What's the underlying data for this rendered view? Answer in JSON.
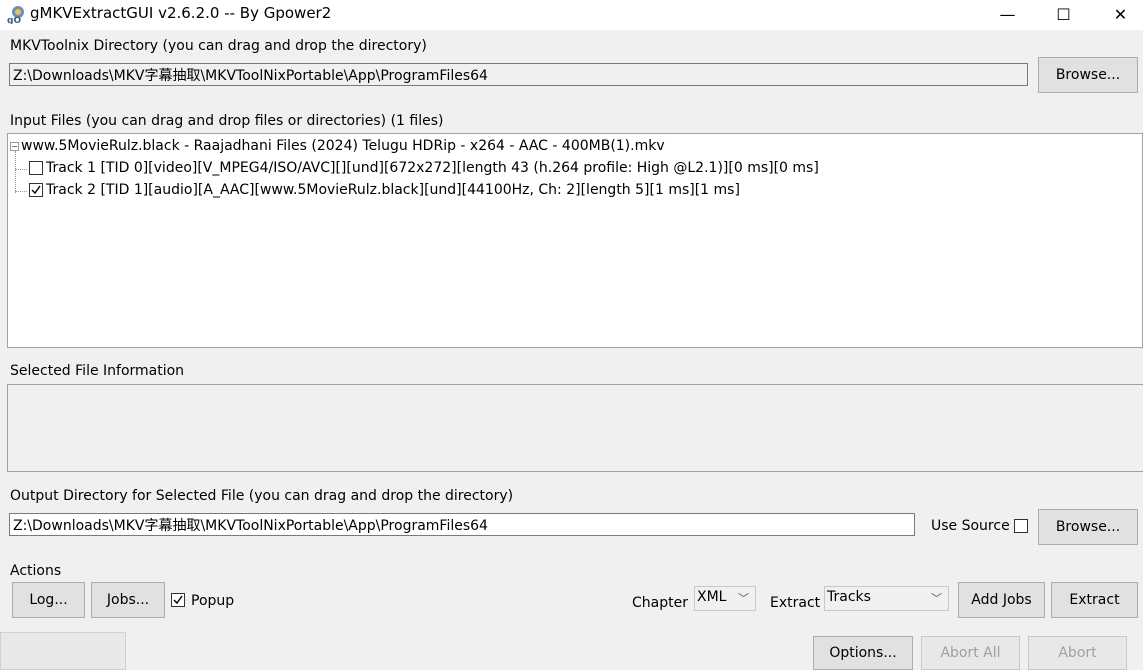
{
  "window": {
    "title": "gMKVExtractGUI v2.6.2.0 -- By Gpower2",
    "minimize_glyph": "—",
    "maximize_glyph": "☐",
    "close_glyph": "✕"
  },
  "mkvtoolnix": {
    "label": "MKVToolnix Directory (you can drag and drop the directory)",
    "path": "Z:\\Downloads\\MKV字幕抽取\\MKVToolNixPortable\\App\\ProgramFiles64",
    "browse_label": "Browse..."
  },
  "input_files": {
    "label": "Input Files (you can drag and drop files or directories) (1 files)",
    "file_name": "www.5MovieRulz.black - Raajadhani Files (2024) Telugu HDRip - x264 - AAC - 400MB(1).mkv",
    "tracks": [
      {
        "label": "Track 1 [TID 0][video][V_MPEG4/ISO/AVC][][und][672x272][length 43 (h.264 profile: High @L2.1)][0 ms][0 ms]",
        "checked": false
      },
      {
        "label": "Track 2 [TID 1][audio][A_AAC][www.5MovieRulz.black][und][44100Hz, Ch: 2][length 5][1 ms][1 ms]",
        "checked": true
      }
    ]
  },
  "selected_info": {
    "label": "Selected File Information"
  },
  "output": {
    "label": "Output Directory for Selected File (you can drag and drop the directory)",
    "path": "Z:\\Downloads\\MKV字幕抽取\\MKVToolNixPortable\\App\\ProgramFiles64",
    "use_source_label": "Use Source",
    "use_source_checked": false,
    "browse_label": "Browse..."
  },
  "actions": {
    "label": "Actions",
    "log_label": "Log...",
    "jobs_label": "Jobs...",
    "popup_label": "Popup",
    "popup_checked": true,
    "chapter_label": "Chapter",
    "chapter_value": "XML",
    "extract_label": "Extract",
    "extract_value": "Tracks",
    "add_jobs_label": "Add Jobs",
    "extract_button_label": "Extract"
  },
  "bottom": {
    "options_label": "Options...",
    "abort_all_label": "Abort All",
    "abort_label": "Abort"
  },
  "colors": {
    "window_bg": "#f0f0f0",
    "titlebar_bg": "#ffffff",
    "button_bg": "#e1e1e1",
    "disabled_text": "#a0a0a0"
  }
}
